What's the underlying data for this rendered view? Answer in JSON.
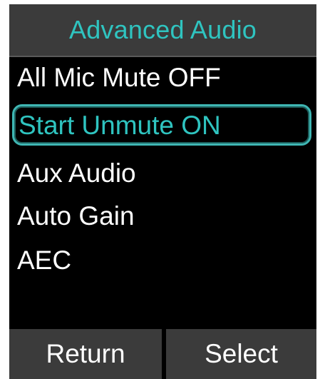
{
  "header": {
    "title": "Advanced Audio"
  },
  "menu": {
    "items": [
      {
        "label": "All Mic Mute OFF",
        "selected": false
      },
      {
        "label": "Start Unmute ON",
        "selected": true
      },
      {
        "label": "Aux Audio",
        "selected": false
      },
      {
        "label": "Auto Gain",
        "selected": false
      },
      {
        "label": "AEC",
        "selected": false
      }
    ]
  },
  "softkeys": {
    "left_label": "Return",
    "right_label": "Select"
  },
  "colors": {
    "accent": "#2fc4c0",
    "header_bg": "#3b3b3b",
    "screen_bg": "#000000",
    "text": "#ffffff"
  }
}
